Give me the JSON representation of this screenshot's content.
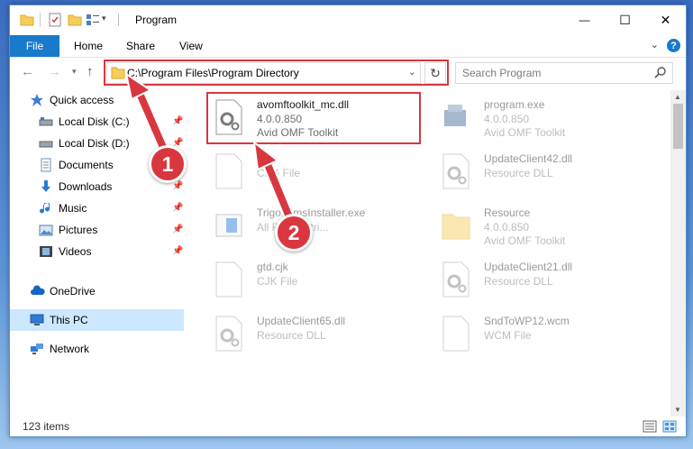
{
  "window": {
    "title": "Program",
    "minimize": "—",
    "maximize": "☐",
    "close": "✕"
  },
  "ribbon": {
    "file": "File",
    "tabs": [
      "Home",
      "Share",
      "View"
    ],
    "help": "?"
  },
  "nav": {
    "address": "C:\\Program Files\\Program Directory",
    "search_placeholder": "Search Program"
  },
  "sidebar": {
    "items": [
      {
        "label": "Quick access",
        "icon": "star-icon"
      },
      {
        "label": "Local Disk (C:)",
        "icon": "drive-icon",
        "pinned": true
      },
      {
        "label": "Local Disk (D:)",
        "icon": "drive-icon",
        "pinned": true
      },
      {
        "label": "Documents",
        "icon": "documents-icon",
        "pinned": true
      },
      {
        "label": "Downloads",
        "icon": "download-icon",
        "pinned": true
      },
      {
        "label": "Music",
        "icon": "music-icon",
        "pinned": true
      },
      {
        "label": "Pictures",
        "icon": "pictures-icon",
        "pinned": true
      },
      {
        "label": "Videos",
        "icon": "videos-icon",
        "pinned": true
      },
      {
        "label": "OneDrive",
        "icon": "cloud-icon"
      },
      {
        "label": "This PC",
        "icon": "monitor-icon"
      },
      {
        "label": "Network",
        "icon": "network-icon"
      }
    ]
  },
  "files": [
    {
      "name": "avomftoolkit_mc.dll",
      "line1": "4.0.0.850",
      "line2": "Avid OMF Toolkit",
      "icon": "dll-gear-icon"
    },
    {
      "name": "program.exe",
      "line1": "4.0.0.850",
      "line2": "Avid OMF Toolkit",
      "icon": "exe-icon"
    },
    {
      "name": "cfg",
      "line1": "CFG File",
      "line2": "",
      "icon": "file-icon"
    },
    {
      "name": "UpdateClient42.dll",
      "line1": "Resource DLL",
      "line2": "",
      "icon": "dll-gear-icon"
    },
    {
      "name": "TrigonomsInstaller.exe",
      "line1": "All Reader tri...",
      "line2": "",
      "icon": "installer-icon"
    },
    {
      "name": "Resource",
      "line1": "4.0.0.850",
      "line2": "Avid OMF Toolkit",
      "icon": "folder-icon"
    },
    {
      "name": "gtd.cjk",
      "line1": "CJK File",
      "line2": "",
      "icon": "file-icon"
    },
    {
      "name": "UpdateClient21.dll",
      "line1": "Resource DLL",
      "line2": "",
      "icon": "dll-gear-icon"
    },
    {
      "name": "UpdateClient65.dll",
      "line1": "Resource DLL",
      "line2": "",
      "icon": "dll-gear-icon"
    },
    {
      "name": "SndToWP12.wcm",
      "line1": "WCM File",
      "line2": "",
      "icon": "file-icon"
    }
  ],
  "status": {
    "item_count": "123 items"
  },
  "annotations": {
    "step1": "1",
    "step2": "2"
  },
  "colors": {
    "accent": "#1979ca",
    "highlight": "#d9373f",
    "selection": "#cce8ff"
  }
}
